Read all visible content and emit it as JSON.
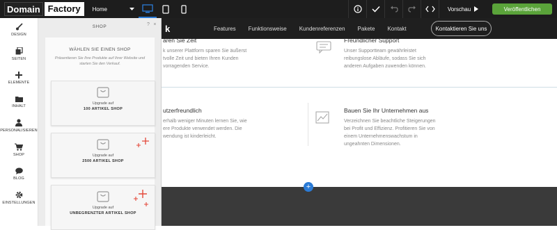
{
  "topbar": {
    "logo_part1": "Domain",
    "logo_part2": "Factory",
    "page_select": "Home",
    "preview_label": "Vorschau",
    "publish_label": "Veröffentlichen"
  },
  "sidebar": {
    "items": [
      {
        "label": "DESIGN",
        "icon": "brush-icon"
      },
      {
        "label": "SEITEN",
        "icon": "pages-icon"
      },
      {
        "label": "ELEMENTE",
        "icon": "plus-icon"
      },
      {
        "label": "INHALT",
        "icon": "folder-icon"
      },
      {
        "label": "PERSONALISIEREN",
        "icon": "person-icon"
      },
      {
        "label": "SHOP",
        "icon": "cart-icon"
      },
      {
        "label": "BLOG",
        "icon": "chat-icon"
      },
      {
        "label": "EINSTELLUNGEN",
        "icon": "gear-icon"
      }
    ]
  },
  "panel": {
    "title": "SHOP",
    "help": "?",
    "close": "×",
    "heading": "WÄHLEN SIE EINEN SHOP",
    "description": "Präsentieren Sie Ihre Produkte auf Ihrer Website und starten Sie den Verkauf.",
    "cards": [
      {
        "line1": "Upgrade auf",
        "line2": "100 ARTIKEL SHOP"
      },
      {
        "line1": "Upgrade auf",
        "line2": "2500 ARTIKEL SHOP"
      },
      {
        "line1": "Upgrade auf",
        "line2": "UNBEGRENZTER ARTIKEL SHOP"
      }
    ]
  },
  "site": {
    "brand": "k",
    "nav_links": [
      "Features",
      "Funktionsweise",
      "Kundenreferenzen",
      "Pakete",
      "Kontakt"
    ],
    "cta": "Kontaktieren Sie uns",
    "features": {
      "f1_title": "aren Sie Zeit",
      "f1_text": [
        "k unserer Plattform sparen Sie äußerst",
        "tvolle Zeit und bieten Ihren Kunden",
        "vorragenden Service."
      ],
      "f2_title": "Freundlicher Support",
      "f2_text": [
        "Unser Supportteam gewährleistet",
        "reibungslose Abläufe, sodass Sie sich",
        "anderen Aufgaben zuwenden können."
      ],
      "f3_title": "utzerfreundlich",
      "f3_text": [
        "erhalb weniger Minuten lernen Sie, wie",
        "ere Produkte verwendet werden. Die",
        "wendung ist kinderleicht."
      ],
      "f4_title": "Bauen Sie Ihr Unternehmen aus",
      "f4_text": [
        "Verzeichnen Sie beachtliche Steigerungen",
        "bei Profit und Effizienz. Profitieren Sie von",
        "einem Unternehmenswachstum in",
        "ungeahnten Dimensionen."
      ]
    },
    "add_section": "+"
  }
}
